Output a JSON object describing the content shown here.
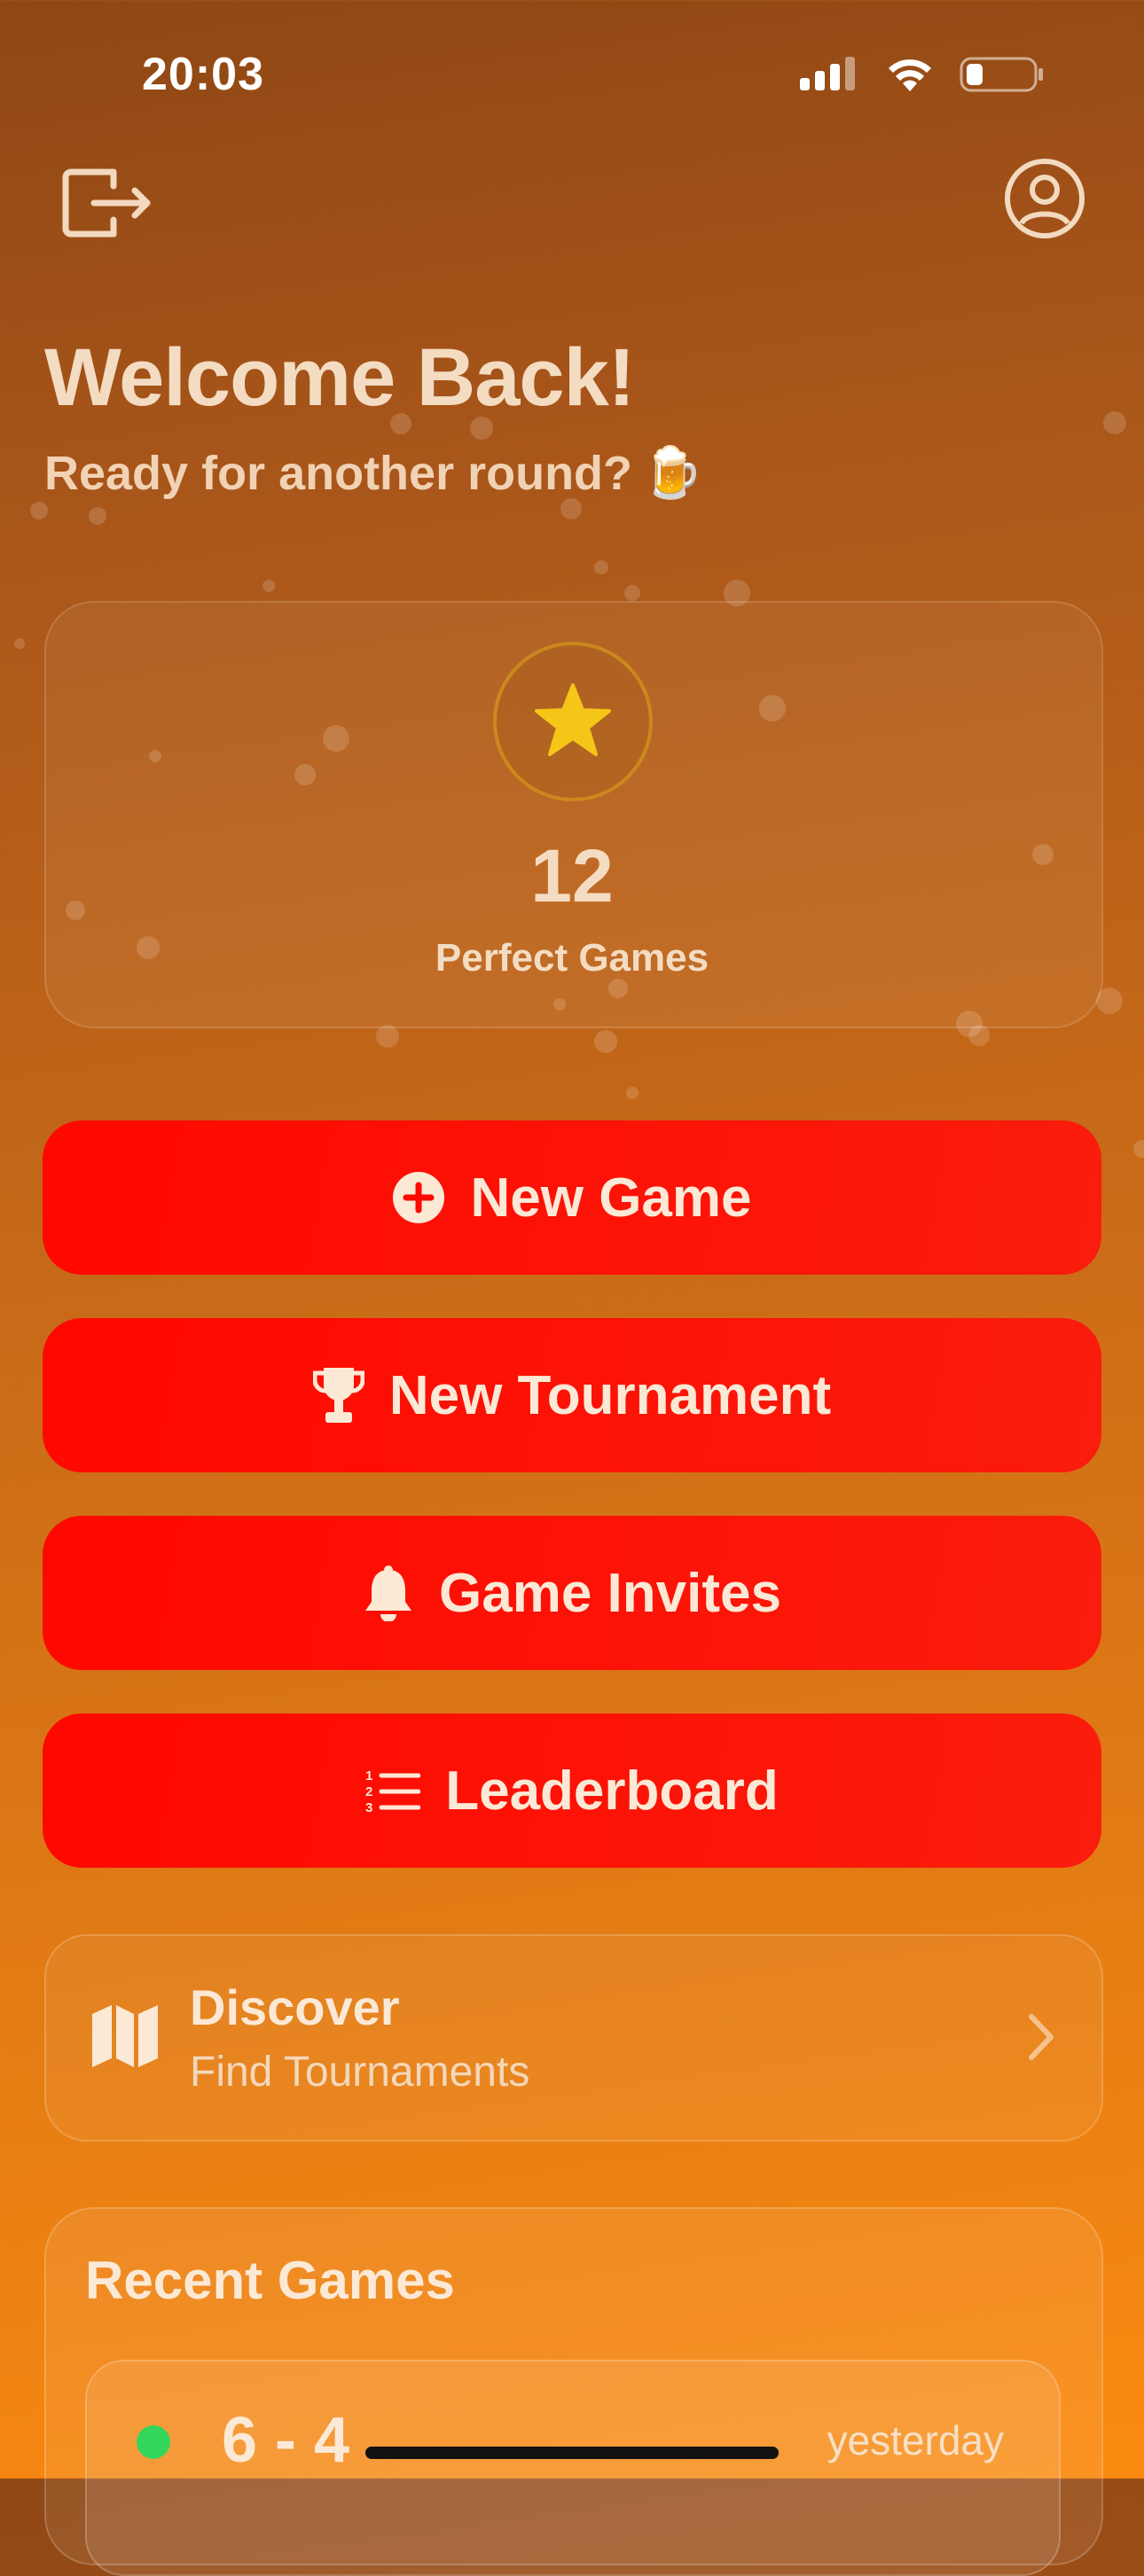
{
  "status_bar": {
    "time": "20:03"
  },
  "header": {
    "title": "Welcome Back!",
    "subtitle": "Ready for another round?",
    "subtitle_emoji": "🍺"
  },
  "stats": {
    "value": "12",
    "label": "Perfect Games",
    "icon": "star-icon"
  },
  "actions": [
    {
      "label": "New Game",
      "icon": "plus-circle-icon"
    },
    {
      "label": "New Tournament",
      "icon": "trophy-icon"
    },
    {
      "label": "Game Invites",
      "icon": "bell-icon"
    },
    {
      "label": "Leaderboard",
      "icon": "numbered-list-icon"
    }
  ],
  "discover": {
    "title": "Discover",
    "subtitle": "Find Tournaments",
    "icon": "map-icon"
  },
  "recent_games": {
    "title": "Recent Games",
    "items": [
      {
        "score": "6 - 4",
        "date": "yesterday",
        "status_color": "#33d65a"
      }
    ]
  },
  "colors": {
    "button_red": "#ff0800",
    "accent_orange": "#e57d14",
    "star_gold": "#f5c518"
  }
}
